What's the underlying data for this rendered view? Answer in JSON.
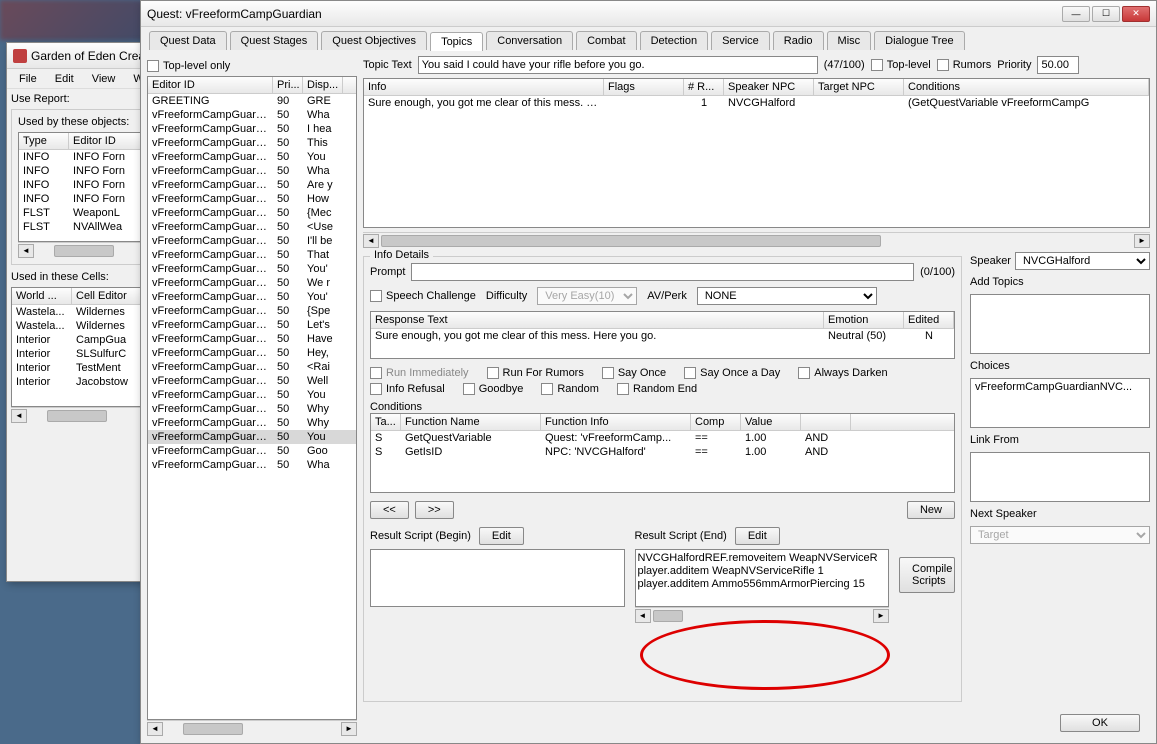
{
  "geck": {
    "title": "Garden of Eden Crea",
    "menubar": [
      "File",
      "Edit",
      "View",
      "Wo"
    ],
    "use_report_label": "Use Report:",
    "used_by_label": "Used by these objects:",
    "used_by_cols": [
      "Type",
      "Editor ID"
    ],
    "used_by_rows": [
      [
        "INFO",
        "INFO Forn"
      ],
      [
        "INFO",
        "INFO Forn"
      ],
      [
        "INFO",
        "INFO Forn"
      ],
      [
        "INFO",
        "INFO Forn"
      ],
      [
        "FLST",
        "WeaponL"
      ],
      [
        "FLST",
        "NVAllWea"
      ]
    ],
    "used_in_label": "Used in these Cells:",
    "used_in_cols": [
      "World ...",
      "Cell Editor"
    ],
    "used_in_rows": [
      [
        "Wastela...",
        "Wildernes"
      ],
      [
        "Wastela...",
        "Wildernes"
      ],
      [
        "Interior",
        "CampGua"
      ],
      [
        "Interior",
        "SLSulfurC"
      ],
      [
        "Interior",
        "TestMent"
      ],
      [
        "Interior",
        "Jacobstow"
      ]
    ]
  },
  "quest": {
    "title": "Quest: vFreeformCampGuardian",
    "tabs": [
      "Quest Data",
      "Quest Stages",
      "Quest Objectives",
      "Topics",
      "Conversation",
      "Combat",
      "Detection",
      "Service",
      "Radio",
      "Misc",
      "Dialogue Tree"
    ],
    "active_tab": 3,
    "top_level_only": "Top-level only",
    "editor_cols": [
      "Editor ID",
      "Pri...",
      "Disp..."
    ],
    "editor_rows": [
      [
        "GREETING",
        "90",
        "GRE"
      ],
      [
        "vFreeformCampGuardi...",
        "50",
        "Wha"
      ],
      [
        "vFreeformCampGuardi...",
        "50",
        "I hea"
      ],
      [
        "vFreeformCampGuardi...",
        "50",
        "This"
      ],
      [
        "vFreeformCampGuardi...",
        "50",
        "You"
      ],
      [
        "vFreeformCampGuardi...",
        "50",
        "Wha"
      ],
      [
        "vFreeformCampGuardi...",
        "50",
        "Are y"
      ],
      [
        "vFreeformCampGuardi...",
        "50",
        "How"
      ],
      [
        "vFreeformCampGuardi...",
        "50",
        "{Mec"
      ],
      [
        "vFreeformCampGuardi...",
        "50",
        "<Use"
      ],
      [
        "vFreeformCampGuardi...",
        "50",
        "I'll be"
      ],
      [
        "vFreeformCampGuardi...",
        "50",
        "That"
      ],
      [
        "vFreeformCampGuardi...",
        "50",
        "You'"
      ],
      [
        "vFreeformCampGuardi...",
        "50",
        "We r"
      ],
      [
        "vFreeformCampGuardi...",
        "50",
        "You'"
      ],
      [
        "vFreeformCampGuardi...",
        "50",
        "{Spe"
      ],
      [
        "vFreeformCampGuardi...",
        "50",
        "Let's"
      ],
      [
        "vFreeformCampGuardi...",
        "50",
        "Have"
      ],
      [
        "vFreeformCampGuardi...",
        "50",
        "Hey,"
      ],
      [
        "vFreeformCampGuardi...",
        "50",
        "<Rai"
      ],
      [
        "vFreeformCampGuardi...",
        "50",
        "Well"
      ],
      [
        "vFreeformCampGuardi...",
        "50",
        "You"
      ],
      [
        "vFreeformCampGuardi...",
        "50",
        "Why"
      ],
      [
        "vFreeformCampGuardi...",
        "50",
        "Why"
      ],
      [
        "vFreeformCampGuardi...",
        "50",
        "You"
      ],
      [
        "vFreeformCampGuardi...",
        "50",
        "Goo"
      ],
      [
        "vFreeformCampGuardi...",
        "50",
        "Wha"
      ]
    ],
    "editor_sel": 24,
    "topic_text_label": "Topic Text",
    "topic_text": "You said I could have your rifle before you go.",
    "counter": "(47/100)",
    "top_level": "Top-level",
    "rumors": "Rumors",
    "priority_label": "Priority",
    "priority": "50.00",
    "info_cols": [
      "Info",
      "Flags",
      "# R...",
      "Speaker NPC",
      "Target NPC",
      "Conditions"
    ],
    "info_row": [
      "Sure enough, you got me clear of this mess. Here ...",
      "",
      "1",
      "NVCGHalford",
      "",
      "(GetQuestVariable vFreeformCampG"
    ],
    "info_details": "Info Details",
    "prompt_label": "Prompt",
    "prompt_count": "(0/100)",
    "speaker_label": "Speaker",
    "speaker": "NVCGHalford",
    "speech_challenge": "Speech Challenge",
    "difficulty_label": "Difficulty",
    "difficulty": "Very Easy(10)",
    "avperk_label": "AV/Perk",
    "avperk": "NONE",
    "response_cols": [
      "Response Text",
      "Emotion",
      "Edited"
    ],
    "response_row": [
      "Sure enough, you got me clear of this mess. Here you go.",
      "Neutral (50)",
      "N"
    ],
    "flags": {
      "run_immediately": "Run Immediately",
      "run_for_rumors": "Run For Rumors",
      "say_once": "Say Once",
      "say_once_a_day": "Say Once a Day",
      "always_darken": "Always Darken",
      "info_refusal": "Info Refusal",
      "goodbye": "Goodbye",
      "random": "Random",
      "random_end": "Random End"
    },
    "conditions_label": "Conditions",
    "cond_cols": [
      "Ta...",
      "Function Name",
      "Function Info",
      "Comp",
      "Value",
      ""
    ],
    "cond_rows": [
      [
        "S",
        "GetQuestVariable",
        "Quest: 'vFreeformCamp...",
        "==",
        "1.00",
        "AND"
      ],
      [
        "S",
        "GetIsID",
        "NPC: 'NVCGHalford'",
        "==",
        "1.00",
        "AND"
      ]
    ],
    "nav_prev": "<<",
    "nav_next": ">>",
    "new_btn": "New",
    "result_begin": "Result Script (Begin)",
    "result_end": "Result Script (End)",
    "edit": "Edit",
    "script_lines": [
      "NVCGHalfordREF.removeitem WeapNVServiceR",
      "player.additem WeapNVServiceRifle 1",
      "player.additem Ammo556mmArmorPiercing 15"
    ],
    "compile": "Compile Scripts",
    "add_topics": "Add Topics",
    "choices": "Choices",
    "choice_item": "vFreeformCampGuardianNVC...",
    "link_from": "Link From",
    "next_speaker": "Next Speaker",
    "target": "Target",
    "ok": "OK"
  }
}
